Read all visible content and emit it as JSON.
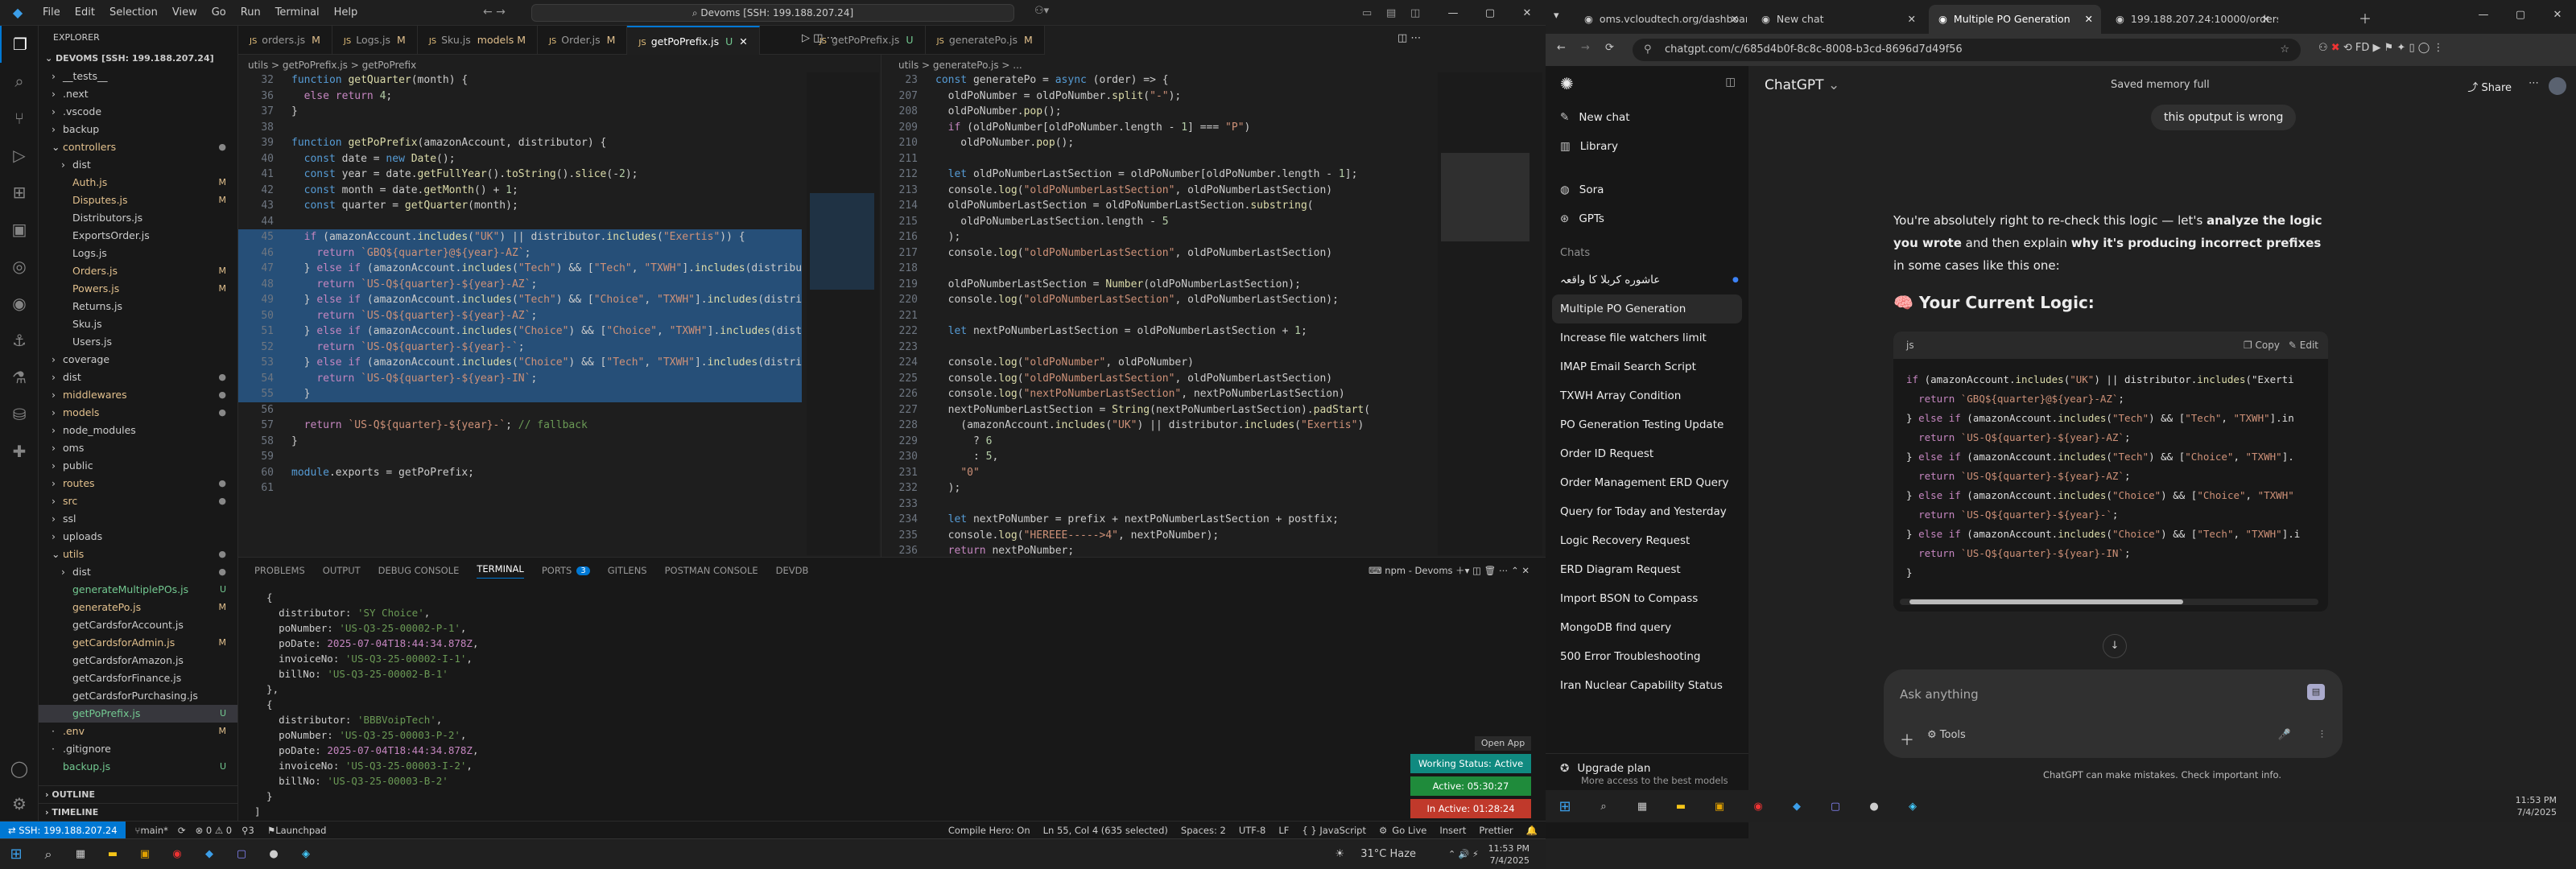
{
  "vscode": {
    "menu": [
      "File",
      "Edit",
      "Selection",
      "View",
      "Go",
      "Run",
      "Terminal",
      "Help"
    ],
    "command_center": "Devoms [SSH: 199.188.207.24]",
    "explorer_title": "EXPLORER",
    "workspace": "DEVOMS [SSH: 199.188.207.24]",
    "tree": [
      {
        "name": "__tests__",
        "indent": 1,
        "kind": "folder"
      },
      {
        "name": ".next",
        "indent": 1,
        "kind": "folder"
      },
      {
        "name": ".vscode",
        "indent": 1,
        "kind": "folder"
      },
      {
        "name": "backup",
        "indent": 1,
        "kind": "folder"
      },
      {
        "name": "controllers",
        "indent": 1,
        "kind": "folder-open",
        "badge": "dot",
        "cls": "mod"
      },
      {
        "name": "dist",
        "indent": 2,
        "kind": "folder"
      },
      {
        "name": "Auth.js",
        "indent": 2,
        "kind": "file",
        "badge": "M",
        "cls": "mod"
      },
      {
        "name": "Disputes.js",
        "indent": 2,
        "kind": "file",
        "badge": "M",
        "cls": "mod"
      },
      {
        "name": "Distributors.js",
        "indent": 2,
        "kind": "file"
      },
      {
        "name": "ExportsOrder.js",
        "indent": 2,
        "kind": "file"
      },
      {
        "name": "Logs.js",
        "indent": 2,
        "kind": "file"
      },
      {
        "name": "Orders.js",
        "indent": 2,
        "kind": "file",
        "badge": "M",
        "cls": "mod"
      },
      {
        "name": "Powers.js",
        "indent": 2,
        "kind": "file",
        "badge": "M",
        "cls": "mod"
      },
      {
        "name": "Returns.js",
        "indent": 2,
        "kind": "file"
      },
      {
        "name": "Sku.js",
        "indent": 2,
        "kind": "file"
      },
      {
        "name": "Users.js",
        "indent": 2,
        "kind": "file"
      },
      {
        "name": "coverage",
        "indent": 1,
        "kind": "folder"
      },
      {
        "name": "dist",
        "indent": 1,
        "kind": "folder",
        "badge": "dot"
      },
      {
        "name": "middlewares",
        "indent": 1,
        "kind": "folder",
        "badge": "dot",
        "cls": "mod"
      },
      {
        "name": "models",
        "indent": 1,
        "kind": "folder",
        "badge": "dot",
        "cls": "mod"
      },
      {
        "name": "node_modules",
        "indent": 1,
        "kind": "folder"
      },
      {
        "name": "oms",
        "indent": 1,
        "kind": "folder"
      },
      {
        "name": "public",
        "indent": 1,
        "kind": "folder"
      },
      {
        "name": "routes",
        "indent": 1,
        "kind": "folder",
        "badge": "dot",
        "cls": "mod"
      },
      {
        "name": "src",
        "indent": 1,
        "kind": "folder",
        "badge": "dot",
        "cls": "mod"
      },
      {
        "name": "ssl",
        "indent": 1,
        "kind": "folder"
      },
      {
        "name": "uploads",
        "indent": 1,
        "kind": "folder"
      },
      {
        "name": "utils",
        "indent": 1,
        "kind": "folder-open",
        "badge": "dot",
        "cls": "mod"
      },
      {
        "name": "dist",
        "indent": 2,
        "kind": "folder",
        "badge": "dot"
      },
      {
        "name": "generateMultiplePOs.js",
        "indent": 2,
        "kind": "file",
        "badge": "U",
        "cls": "unt"
      },
      {
        "name": "generatePo.js",
        "indent": 2,
        "kind": "file",
        "badge": "M",
        "cls": "mod"
      },
      {
        "name": "getCardsforAccount.js",
        "indent": 2,
        "kind": "file"
      },
      {
        "name": "getCardsforAdmin.js",
        "indent": 2,
        "kind": "file",
        "badge": "M",
        "cls": "mod"
      },
      {
        "name": "getCardsforAmazon.js",
        "indent": 2,
        "kind": "file"
      },
      {
        "name": "getCardsforFinance.js",
        "indent": 2,
        "kind": "file"
      },
      {
        "name": "getCardsforPurchasing.js",
        "indent": 2,
        "kind": "file"
      },
      {
        "name": "getPoPrefix.js",
        "indent": 2,
        "kind": "file",
        "badge": "U",
        "cls": "unt",
        "selected": true
      },
      {
        "name": ".env",
        "indent": 1,
        "kind": "file",
        "badge": "M",
        "cls": "mod"
      },
      {
        "name": ".gitignore",
        "indent": 1,
        "kind": "file"
      },
      {
        "name": "backup.js",
        "indent": 1,
        "kind": "file",
        "badge": "U",
        "cls": "unt"
      }
    ],
    "outline": "OUTLINE",
    "timeline": "TIMELINE",
    "tabs": [
      {
        "label": "orders.js",
        "badge": "M"
      },
      {
        "label": "Logs.js",
        "badge": "M"
      },
      {
        "label": "Sku.js",
        "badge": "models M"
      },
      {
        "label": "Order.js",
        "badge": "M"
      },
      {
        "label": "getPoPrefix.js",
        "badge": "U",
        "active": true
      },
      {
        "label": "getPoPrefix.js",
        "badge": "U"
      },
      {
        "label": "generatePo.js",
        "badge": "M"
      }
    ],
    "left_breadcrumb": "utils > getPoPrefix.js > getPoPrefix",
    "right_breadcrumb": "utils > generatePo.js > ...",
    "left_code": [
      {
        "n": "32",
        "t": "function getQuarter(month) {"
      },
      {
        "n": "36",
        "t": "  else return 4;"
      },
      {
        "n": "37",
        "t": "}"
      },
      {
        "n": "38",
        "t": ""
      },
      {
        "n": "39",
        "t": "function getPoPrefix(amazonAccount, distributor) {"
      },
      {
        "n": "40",
        "t": "  const date = new Date();"
      },
      {
        "n": "41",
        "t": "  const year = date.getFullYear().toString().slice(-2);"
      },
      {
        "n": "42",
        "t": "  const month = date.getMonth() + 1;"
      },
      {
        "n": "43",
        "t": "  const quarter = getQuarter(month);"
      },
      {
        "n": "44",
        "t": ""
      },
      {
        "n": "45",
        "t": "  if (amazonAccount.includes(\"UK\") || distributor.includes(\"Exertis\")) {",
        "sel": true
      },
      {
        "n": "46",
        "t": "    return `GBQ${quarter}@${year}-AZ`;",
        "sel": true
      },
      {
        "n": "47",
        "t": "  } else if (amazonAccount.includes(\"Tech\") && [\"Tech\", \"TXWH\"].includes(distribut",
        "sel": true
      },
      {
        "n": "48",
        "t": "    return `US-Q${quarter}-${year}-AZ`;",
        "sel": true
      },
      {
        "n": "49",
        "t": "  } else if (amazonAccount.includes(\"Tech\") && [\"Choice\", \"TXWH\"].includes(distribu",
        "sel": true
      },
      {
        "n": "50",
        "t": "    return `US-Q${quarter}-${year}-AZ`;",
        "sel": true
      },
      {
        "n": "51",
        "t": "  } else if (amazonAccount.includes(\"Choice\") && [\"Choice\", \"TXWH\"].includes(distrib",
        "sel": true
      },
      {
        "n": "52",
        "t": "    return `US-Q${quarter}-${year}-`;",
        "sel": true
      },
      {
        "n": "53",
        "t": "  } else if (amazonAccount.includes(\"Choice\") && [\"Tech\", \"TXWH\"].includes(distrib",
        "sel": true
      },
      {
        "n": "54",
        "t": "    return `US-Q${quarter}-${year}-IN`;",
        "sel": true
      },
      {
        "n": "55",
        "t": "  }",
        "sel": true
      },
      {
        "n": "56",
        "t": ""
      },
      {
        "n": "57",
        "t": "  return `US-Q${quarter}-${year}-`; // fallback"
      },
      {
        "n": "58",
        "t": "}"
      },
      {
        "n": "59",
        "t": ""
      },
      {
        "n": "60",
        "t": "module.exports = getPoPrefix;"
      },
      {
        "n": "61",
        "t": ""
      }
    ],
    "right_code": [
      {
        "n": "23",
        "t": "const generatePo = async (order) => {"
      },
      {
        "n": "207",
        "t": "  oldPoNumber = oldPoNumber.split(\"-\");"
      },
      {
        "n": "208",
        "t": "  oldPoNumber.pop();"
      },
      {
        "n": "209",
        "t": "  if (oldPoNumber[oldPoNumber.length - 1] === \"P\")"
      },
      {
        "n": "210",
        "t": "    oldPoNumber.pop();"
      },
      {
        "n": "211",
        "t": ""
      },
      {
        "n": "212",
        "t": "  let oldPoNumberLastSection = oldPoNumber[oldPoNumber.length - 1];"
      },
      {
        "n": "213",
        "t": "  console.log(\"oldPoNumberLastSection\", oldPoNumberLastSection)"
      },
      {
        "n": "214",
        "t": "  oldPoNumberLastSection = oldPoNumberLastSection.substring("
      },
      {
        "n": "215",
        "t": "    oldPoNumberLastSection.length - 5"
      },
      {
        "n": "216",
        "t": "  );"
      },
      {
        "n": "217",
        "t": "  console.log(\"oldPoNumberLastSection\", oldPoNumberLastSection)"
      },
      {
        "n": "218",
        "t": ""
      },
      {
        "n": "219",
        "t": "  oldPoNumberLastSection = Number(oldPoNumberLastSection);"
      },
      {
        "n": "220",
        "t": "  console.log(\"oldPoNumberLastSection\", oldPoNumberLastSection);"
      },
      {
        "n": "221",
        "t": ""
      },
      {
        "n": "222",
        "t": "  let nextPoNumberLastSection = oldPoNumberLastSection + 1;"
      },
      {
        "n": "223",
        "t": ""
      },
      {
        "n": "224",
        "t": "  console.log(\"oldPoNumber\", oldPoNumber)"
      },
      {
        "n": "225",
        "t": "  console.log(\"oldPoNumberLastSection\", oldPoNumberLastSection)"
      },
      {
        "n": "226",
        "t": "  console.log(\"nextPoNumberLastSection\", nextPoNumberLastSection)"
      },
      {
        "n": "227",
        "t": "  nextPoNumberLastSection = String(nextPoNumberLastSection).padStart("
      },
      {
        "n": "228",
        "t": "    (amazonAccount.includes(\"UK\") || distributor.includes(\"Exertis\")"
      },
      {
        "n": "229",
        "t": "      ? 6"
      },
      {
        "n": "230",
        "t": "      : 5,"
      },
      {
        "n": "231",
        "t": "    \"0\""
      },
      {
        "n": "232",
        "t": "  );"
      },
      {
        "n": "233",
        "t": ""
      },
      {
        "n": "234",
        "t": "  let nextPoNumber = prefix + nextPoNumberLastSection + postfix;"
      },
      {
        "n": "235",
        "t": "  console.log(\"HEREEE----->4\", nextPoNumber);"
      },
      {
        "n": "236",
        "t": "  return nextPoNumber;"
      }
    ],
    "panel_tabs": [
      "PROBLEMS",
      "OUTPUT",
      "DEBUG CONSOLE",
      "TERMINAL",
      "PORTS",
      "GITLENS",
      "POSTMAN CONSOLE",
      "DEVDB"
    ],
    "ports_count": "3",
    "terminal_name": "npm - Devoms",
    "terminal": [
      "  {",
      "    distributor: 'SY Choice',",
      "    poNumber: 'US-Q3-25-00002-P-1',",
      "    poDate: 2025-07-04T18:44:34.878Z,",
      "    invoiceNo: 'US-Q3-25-00002-I-1',",
      "    billNo: 'US-Q3-25-00002-B-1'",
      "  },",
      "  {",
      "    distributor: 'BBBVoipTech',",
      "    poNumber: 'US-Q3-25-00003-P-2',",
      "    poDate: 2025-07-04T18:44:34.878Z,",
      "    invoiceNo: 'US-Q3-25-00003-I-2',",
      "    billNo: 'US-Q3-25-00003-B-2'",
      "  }",
      "]"
    ],
    "open_app": "Open App",
    "status_working": "Working Status: Active",
    "status_active": "Active: 05:30:27",
    "status_inactive": "In Active: 01:28:24",
    "statusbar": {
      "remote": "SSH: 199.188.207.24",
      "branch": "main*",
      "problems": "⊗ 0  ⚠ 0",
      "ports": "3",
      "launchpad": "Launchpad",
      "compile": "Compile Hero: On",
      "pos": "Ln 55, Col 4 (635 selected)",
      "spaces": "Spaces: 2",
      "enc": "UTF-8",
      "eol": "LF",
      "lang": "{ } JavaScript",
      "golive": "Go Live",
      "insert": "Insert",
      "prettier": "Prettier"
    },
    "taskbar": {
      "weather": "31°C  Haze",
      "time": "11:53 PM",
      "date": "7/4/2025"
    }
  },
  "chrome": {
    "tabs": [
      "oms.vcloudtech.org/dashboard",
      "New chat",
      "Multiple PO Generation",
      "199.188.207.24:10000/orders/..."
    ],
    "active_tab": 2,
    "url": "chatgpt.com/c/685d4b0f-8c8c-8008-b3cd-8696d7d49f56",
    "sidebar_items": [
      {
        "label": "New chat",
        "icon": "edit-icon"
      },
      {
        "label": "Library",
        "icon": "library-icon"
      },
      {
        "label": "Sora",
        "icon": "sora-icon"
      },
      {
        "label": "GPTs",
        "icon": "gpts-icon"
      }
    ],
    "chats_heading": "Chats",
    "chats": [
      "عاشوره کربلا کا واقعہ",
      "Multiple PO Generation",
      "Increase file watchers limit",
      "IMAP Email Search Script",
      "TXWH Array Condition",
      "PO Generation Testing Update",
      "Order ID Request",
      "Order Management ERD Query",
      "Query for Today and Yesterday",
      "Logic Recovery Request",
      "ERD Diagram Request",
      "Import BSON to Compass",
      "MongoDB find query",
      "500 Error Troubleshooting",
      "Iran Nuclear Capability Status"
    ],
    "upgrade_title": "Upgrade plan",
    "upgrade_sub": "More access to the best models",
    "model": "ChatGPT",
    "memory": "Saved memory full",
    "share": "Share",
    "user_msg": "this oputput is wrong",
    "assistant_intro_1": "You're absolutely right to re-check this logic — let's ",
    "assistant_intro_b1": "analyze the logic you wrote",
    "assistant_intro_2": " and then explain ",
    "assistant_intro_b2": "why it's producing incorrect prefixes",
    "assistant_intro_3": " in some cases like this one:",
    "heading": "🧠 Your Current Logic:",
    "code_lang": "js",
    "copy": "Copy",
    "edit": "Edit",
    "code": [
      "if (amazonAccount.includes(\"UK\") || distributor.includes(\"Exerti",
      "  return `GBQ${quarter}@${year}-AZ`;",
      "} else if (amazonAccount.includes(\"Tech\") && [\"Tech\", \"TXWH\"].in",
      "  return `US-Q${quarter}-${year}-AZ`;",
      "} else if (amazonAccount.includes(\"Tech\") && [\"Choice\", \"TXWH\"].",
      "  return `US-Q${quarter}-${year}-AZ`;",
      "} else if (amazonAccount.includes(\"Choice\") && [\"Choice\", \"TXWH\"",
      "  return `US-Q${quarter}-${year}-`;",
      "} else if (amazonAccount.includes(\"Choice\") && [\"Tech\", \"TXWH\"].i",
      "  return `US-Q${quarter}-${year}-IN`;",
      "}"
    ],
    "placeholder": "Ask anything",
    "tools": "Tools",
    "disclaimer": "ChatGPT can make mistakes. Check important info.",
    "time": "11:53 PM",
    "date": "7/4/2025"
  }
}
